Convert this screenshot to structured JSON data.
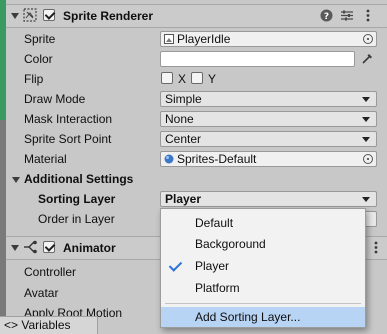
{
  "sprite_renderer": {
    "title": "Sprite Renderer",
    "sprite_label": "Sprite",
    "sprite_value": "PlayerIdle",
    "color_label": "Color",
    "flip_label": "Flip",
    "flip_x": "X",
    "flip_y": "Y",
    "draw_mode_label": "Draw Mode",
    "draw_mode_value": "Simple",
    "mask_interaction_label": "Mask Interaction",
    "mask_interaction_value": "None",
    "sort_point_label": "Sprite Sort Point",
    "sort_point_value": "Center",
    "material_label": "Material",
    "material_value": "Sprites-Default",
    "additional_settings_label": "Additional Settings",
    "sorting_layer_label": "Sorting Layer",
    "sorting_layer_value": "Player",
    "order_in_layer_label": "Order in Layer"
  },
  "sorting_layer_menu": {
    "items": [
      "Default",
      "Backgoround",
      "Player",
      "Platform"
    ],
    "selected": "Player",
    "add_item": "Add Sorting Layer..."
  },
  "animator": {
    "title": "Animator",
    "controller_label": "Controller",
    "avatar_label": "Avatar",
    "apply_root_motion_label": "Apply Root Motion"
  },
  "bottom_tab": {
    "label": "<> Variables"
  },
  "colors": {
    "panel_bg": "#c8c8c8",
    "menu_highlight": "#b8d4f4",
    "check_blue": "#2a73d9",
    "left_strip": "#3a9a62"
  }
}
